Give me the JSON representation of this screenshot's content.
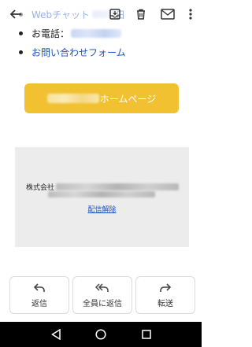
{
  "email": {
    "list_items": [
      {
        "text": "Webチャット",
        "trailing": "日"
      },
      {
        "prefix": "お電話："
      },
      {
        "text": "お問い合わせフォーム"
      }
    ],
    "homepage_button_label": "ホームページ",
    "footer": {
      "company_prefix": "株式会社",
      "unsubscribe_label": "配信解除"
    }
  },
  "actions": {
    "reply_label": "返信",
    "reply_all_label": "全員に返信",
    "forward_label": "転送"
  },
  "icons": [
    "back-arrow-icon",
    "archive-icon",
    "delete-icon",
    "mail-icon",
    "more-vert-icon",
    "reply-icon",
    "reply-all-icon",
    "forward-icon",
    "nav-back-icon",
    "nav-home-icon",
    "nav-recents-icon"
  ],
  "colors": {
    "accent": "#f1c132",
    "link": "#1a56c4",
    "footer_bg": "#ececec"
  }
}
